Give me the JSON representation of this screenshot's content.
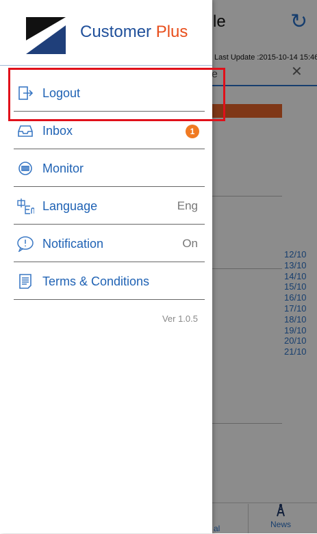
{
  "background": {
    "title_fragment": "le",
    "last_update": "Last Update :2015-10-14 15:46",
    "search_fragment": "e",
    "search_clear": "✕",
    "dates": [
      "12/10",
      "13/10",
      "14/10",
      "15/10",
      "16/10",
      "17/10",
      "18/10",
      "19/10",
      "20/10",
      "21/10"
    ],
    "tab_fragment": "al",
    "news_label": "News"
  },
  "drawer": {
    "brand_name": "Customer ",
    "brand_plus": "Plus",
    "items": [
      {
        "label": "Logout",
        "icon": "logout-icon"
      },
      {
        "label": "Inbox",
        "icon": "inbox-icon",
        "badge": "1"
      },
      {
        "label": "Monitor",
        "icon": "monitor-icon"
      },
      {
        "label": "Language",
        "icon": "language-icon",
        "value": "Eng"
      },
      {
        "label": "Notification",
        "icon": "notification-icon",
        "value": "On"
      },
      {
        "label": "Terms & Conditions",
        "icon": "terms-icon"
      }
    ],
    "version": "Ver 1.0.5"
  },
  "colors": {
    "accent_blue": "#1f62b4",
    "brand_orange": "#e84e1b",
    "badge_orange": "#f07a22",
    "highlight_red": "#e0101a"
  }
}
